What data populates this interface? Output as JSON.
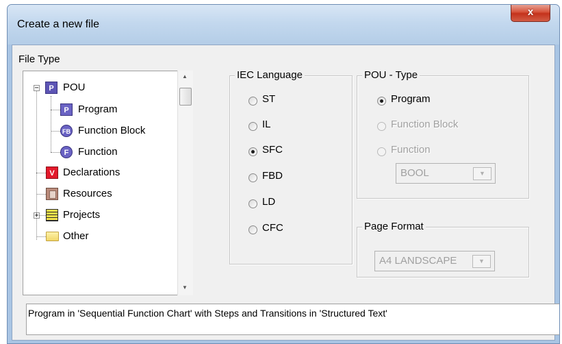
{
  "window": {
    "title": "Create a new file",
    "close_glyph": "x"
  },
  "file_type": {
    "label": "File Type",
    "tree": [
      {
        "label": "POU",
        "icon": "pou-icon",
        "expander": "−"
      },
      {
        "label": "Program",
        "icon": "program-icon",
        "icon_text": "P"
      },
      {
        "label": "Function Block",
        "icon": "function-block-icon",
        "icon_text": "FB"
      },
      {
        "label": "Function",
        "icon": "function-icon",
        "icon_text": "F"
      },
      {
        "label": "Declarations",
        "icon": "declarations-icon",
        "icon_text": "V"
      },
      {
        "label": "Resources",
        "icon": "resources-icon"
      },
      {
        "label": "Projects",
        "icon": "projects-icon",
        "expander": "+"
      },
      {
        "label": "Other",
        "icon": "folder-icon"
      }
    ]
  },
  "iec_language": {
    "label": "IEC Language",
    "options": [
      "ST",
      "IL",
      "SFC",
      "FBD",
      "LD",
      "CFC"
    ],
    "selected": "SFC"
  },
  "pou_type": {
    "label": "POU - Type",
    "options": [
      "Program",
      "Function Block",
      "Function"
    ],
    "selected": "Program",
    "return_type_value": "BOOL"
  },
  "page_format": {
    "label": "Page Format",
    "value": "A4 LANDSCAPE"
  },
  "description": "Program in 'Sequential Function Chart' with Steps and Transitions in 'Structured Text'",
  "colors": {
    "title_bar": "#c3d8ee",
    "close_button": "#d8553e",
    "dialog_bg": "#f0f0f0"
  }
}
